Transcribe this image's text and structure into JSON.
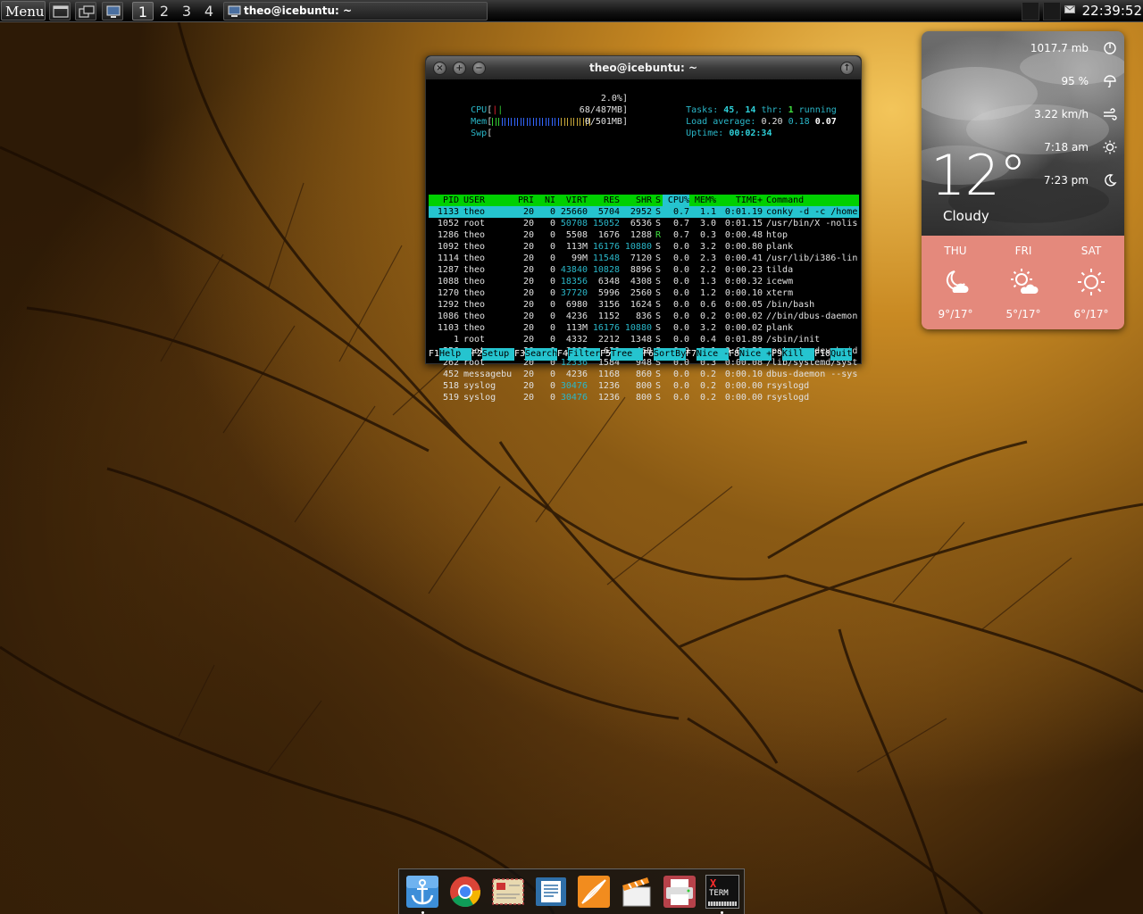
{
  "taskbar": {
    "menu_label": "Menu",
    "workspaces": [
      "1",
      "2",
      "3",
      "4"
    ],
    "active_workspace": "1",
    "task_title": "theo@icebuntu: ~",
    "clock": "22:39:52"
  },
  "terminal": {
    "title": "theo@icebuntu: ~",
    "meters": {
      "cpu_label": "CPU",
      "cpu_value": "2.0%",
      "mem_label": "Mem",
      "mem_value": "68/487MB",
      "swp_label": "Swp",
      "swp_value": "0/501MB",
      "tasks_label": "Tasks:",
      "tasks": "45",
      "thr": "14",
      "thr_label": "thr:",
      "running": "1",
      "running_label": "running",
      "load_label": "Load average:",
      "load1": "0.20",
      "load5": "0.18",
      "load15": "0.07",
      "uptime_label": "Uptime:",
      "uptime": "00:02:34"
    },
    "columns": [
      "PID",
      "USER",
      "PRI",
      "NI",
      "VIRT",
      "RES",
      "SHR",
      "S",
      "CPU%",
      "MEM%",
      "TIME+",
      "Command"
    ],
    "processes": [
      {
        "pid": "1133",
        "user": "theo",
        "pri": "20",
        "ni": "0",
        "virt": "25660",
        "res": "5704",
        "shr": "2952",
        "s": "S",
        "cpu": "0.7",
        "mem": "1.1",
        "time": "0:01.19",
        "cmd": "conky -d -c /home"
      },
      {
        "pid": "1052",
        "user": "root",
        "pri": "20",
        "ni": "0",
        "virt": "50708",
        "res": "15052",
        "shr": "6536",
        "s": "S",
        "cpu": "0.7",
        "mem": "3.0",
        "time": "0:01.15",
        "cmd": "/usr/bin/X -nolis"
      },
      {
        "pid": "1286",
        "user": "theo",
        "pri": "20",
        "ni": "0",
        "virt": "5508",
        "res": "1676",
        "shr": "1288",
        "s": "R",
        "cpu": "0.7",
        "mem": "0.3",
        "time": "0:00.48",
        "cmd": "htop"
      },
      {
        "pid": "1092",
        "user": "theo",
        "pri": "20",
        "ni": "0",
        "virt": "113M",
        "res": "16176",
        "shr": "10880",
        "s": "S",
        "cpu": "0.0",
        "mem": "3.2",
        "time": "0:00.80",
        "cmd": "plank"
      },
      {
        "pid": "1114",
        "user": "theo",
        "pri": "20",
        "ni": "0",
        "virt": "99M",
        "res": "11548",
        "shr": "7120",
        "s": "S",
        "cpu": "0.0",
        "mem": "2.3",
        "time": "0:00.41",
        "cmd": "/usr/lib/i386-lin"
      },
      {
        "pid": "1287",
        "user": "theo",
        "pri": "20",
        "ni": "0",
        "virt": "43840",
        "res": "10828",
        "shr": "8896",
        "s": "S",
        "cpu": "0.0",
        "mem": "2.2",
        "time": "0:00.23",
        "cmd": "tilda"
      },
      {
        "pid": "1088",
        "user": "theo",
        "pri": "20",
        "ni": "0",
        "virt": "18356",
        "res": "6348",
        "shr": "4308",
        "s": "S",
        "cpu": "0.0",
        "mem": "1.3",
        "time": "0:00.32",
        "cmd": "icewm"
      },
      {
        "pid": "1270",
        "user": "theo",
        "pri": "20",
        "ni": "0",
        "virt": "37720",
        "res": "5996",
        "shr": "2560",
        "s": "S",
        "cpu": "0.0",
        "mem": "1.2",
        "time": "0:00.10",
        "cmd": "xterm"
      },
      {
        "pid": "1292",
        "user": "theo",
        "pri": "20",
        "ni": "0",
        "virt": "6980",
        "res": "3156",
        "shr": "1624",
        "s": "S",
        "cpu": "0.0",
        "mem": "0.6",
        "time": "0:00.05",
        "cmd": "/bin/bash"
      },
      {
        "pid": "1086",
        "user": "theo",
        "pri": "20",
        "ni": "0",
        "virt": "4236",
        "res": "1152",
        "shr": "836",
        "s": "S",
        "cpu": "0.0",
        "mem": "0.2",
        "time": "0:00.02",
        "cmd": "//bin/dbus-daemon"
      },
      {
        "pid": "1103",
        "user": "theo",
        "pri": "20",
        "ni": "0",
        "virt": "113M",
        "res": "16176",
        "shr": "10880",
        "s": "S",
        "cpu": "0.0",
        "mem": "3.2",
        "time": "0:00.02",
        "cmd": "plank"
      },
      {
        "pid": "1",
        "user": "root",
        "pri": "20",
        "ni": "0",
        "virt": "4332",
        "res": "2212",
        "shr": "1348",
        "s": "S",
        "cpu": "0.0",
        "mem": "0.4",
        "time": "0:01.89",
        "cmd": "/sbin/init"
      },
      {
        "pid": "256",
        "user": "root",
        "pri": "20",
        "ni": "0",
        "virt": "3008",
        "res": "620",
        "shr": "468",
        "s": "S",
        "cpu": "0.0",
        "mem": "0.1",
        "time": "0:00.26",
        "cmd": "upstart-udev-brid"
      },
      {
        "pid": "262",
        "user": "root",
        "pri": "20",
        "ni": "0",
        "virt": "12336",
        "res": "1584",
        "shr": "948",
        "s": "S",
        "cpu": "0.0",
        "mem": "0.3",
        "time": "0:00.08",
        "cmd": "/lib/systemd/syst"
      },
      {
        "pid": "452",
        "user": "messagebu",
        "pri": "20",
        "ni": "0",
        "virt": "4236",
        "res": "1168",
        "shr": "860",
        "s": "S",
        "cpu": "0.0",
        "mem": "0.2",
        "time": "0:00.10",
        "cmd": "dbus-daemon --sys"
      },
      {
        "pid": "518",
        "user": "syslog",
        "pri": "20",
        "ni": "0",
        "virt": "30476",
        "res": "1236",
        "shr": "800",
        "s": "S",
        "cpu": "0.0",
        "mem": "0.2",
        "time": "0:00.00",
        "cmd": "rsyslogd"
      },
      {
        "pid": "519",
        "user": "syslog",
        "pri": "20",
        "ni": "0",
        "virt": "30476",
        "res": "1236",
        "shr": "800",
        "s": "S",
        "cpu": "0.0",
        "mem": "0.2",
        "time": "0:00.00",
        "cmd": "rsyslogd"
      }
    ],
    "fkeys": [
      {
        "key": "F1",
        "label": "Help  "
      },
      {
        "key": "F2",
        "label": "Setup "
      },
      {
        "key": "F3",
        "label": "Search"
      },
      {
        "key": "F4",
        "label": "Filter"
      },
      {
        "key": "F5",
        "label": "Tree  "
      },
      {
        "key": "F6",
        "label": "SortBy"
      },
      {
        "key": "F7",
        "label": "Nice -"
      },
      {
        "key": "F8",
        "label": "Nice +"
      },
      {
        "key": "F9",
        "label": "Kill  "
      },
      {
        "key": "F10",
        "label": "Quit"
      }
    ]
  },
  "weather": {
    "pressure": "1017.7 mb",
    "humidity": "95 %",
    "wind": "3.22 km/h",
    "sunrise": "7:18 am",
    "sunset": "7:23 pm",
    "temperature": "12°",
    "condition": "Cloudy",
    "forecast": [
      {
        "day": "THU",
        "icon": "moon-cloud-icon",
        "temps": "9°/17°"
      },
      {
        "day": "FRI",
        "icon": "sun-cloud-icon",
        "temps": "5°/17°"
      },
      {
        "day": "SAT",
        "icon": "sun-icon",
        "temps": "6°/17°"
      }
    ],
    "colors": {
      "forecast_bg": "#e4897c"
    }
  },
  "dock": {
    "items": [
      "anchor-icon",
      "chrome-icon",
      "mail-icon",
      "document-icon",
      "orange-icon",
      "clapper-icon",
      "printer-icon",
      "xterm-icon"
    ],
    "xterm_label_1": "X",
    "xterm_label_2": "TERM"
  },
  "colors": {
    "htop_header": "#00d000",
    "htop_selected": "#25c4cf",
    "htop_cyan": "#2ab7c9"
  }
}
